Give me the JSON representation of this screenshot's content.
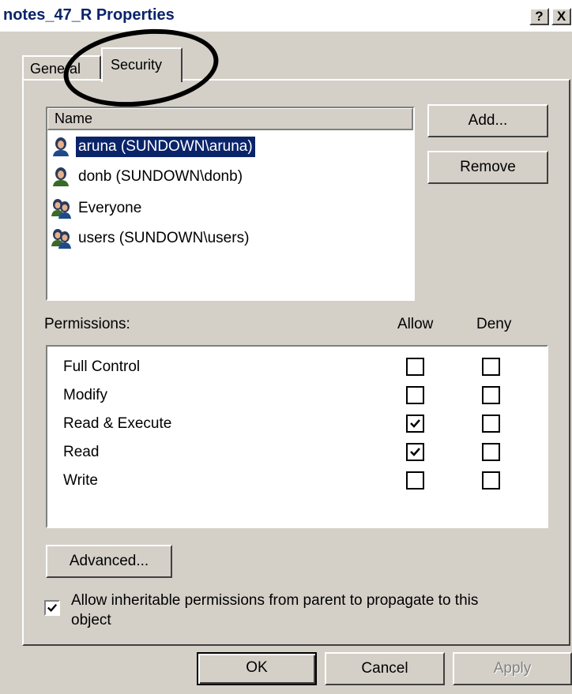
{
  "window": {
    "title": "notes_47_R Properties",
    "help_label": "?",
    "close_label": "X"
  },
  "tabs": [
    {
      "label": "General",
      "active": false
    },
    {
      "label": "Security",
      "active": true
    }
  ],
  "users": {
    "header": "Name",
    "items": [
      {
        "label": "aruna (SUNDOWN\\aruna)",
        "icon": "user-icon",
        "selected": true
      },
      {
        "label": "donb (SUNDOWN\\donb)",
        "icon": "user-icon",
        "selected": false
      },
      {
        "label": "Everyone",
        "icon": "group-icon",
        "selected": false
      },
      {
        "label": "users (SUNDOWN\\users)",
        "icon": "group-icon",
        "selected": false
      }
    ]
  },
  "buttons": {
    "add": "Add...",
    "remove": "Remove",
    "advanced": "Advanced...",
    "ok": "OK",
    "cancel": "Cancel",
    "apply": "Apply"
  },
  "permissions": {
    "label": "Permissions:",
    "allow_header": "Allow",
    "deny_header": "Deny",
    "rows": [
      {
        "name": "Full Control",
        "allow": false,
        "deny": false
      },
      {
        "name": "Modify",
        "allow": false,
        "deny": false
      },
      {
        "name": "Read & Execute",
        "allow": true,
        "deny": false
      },
      {
        "name": "Read",
        "allow": true,
        "deny": false
      },
      {
        "name": "Write",
        "allow": false,
        "deny": false
      }
    ]
  },
  "inherit": {
    "checked": true,
    "line1": "Allow inheritable permissions from parent to propagate to this",
    "line2": "object"
  },
  "colors": {
    "dialog_bg": "#d4d0c8",
    "selection": "#0a246a",
    "title_text": "#0a246a",
    "disabled_text": "#808080"
  }
}
